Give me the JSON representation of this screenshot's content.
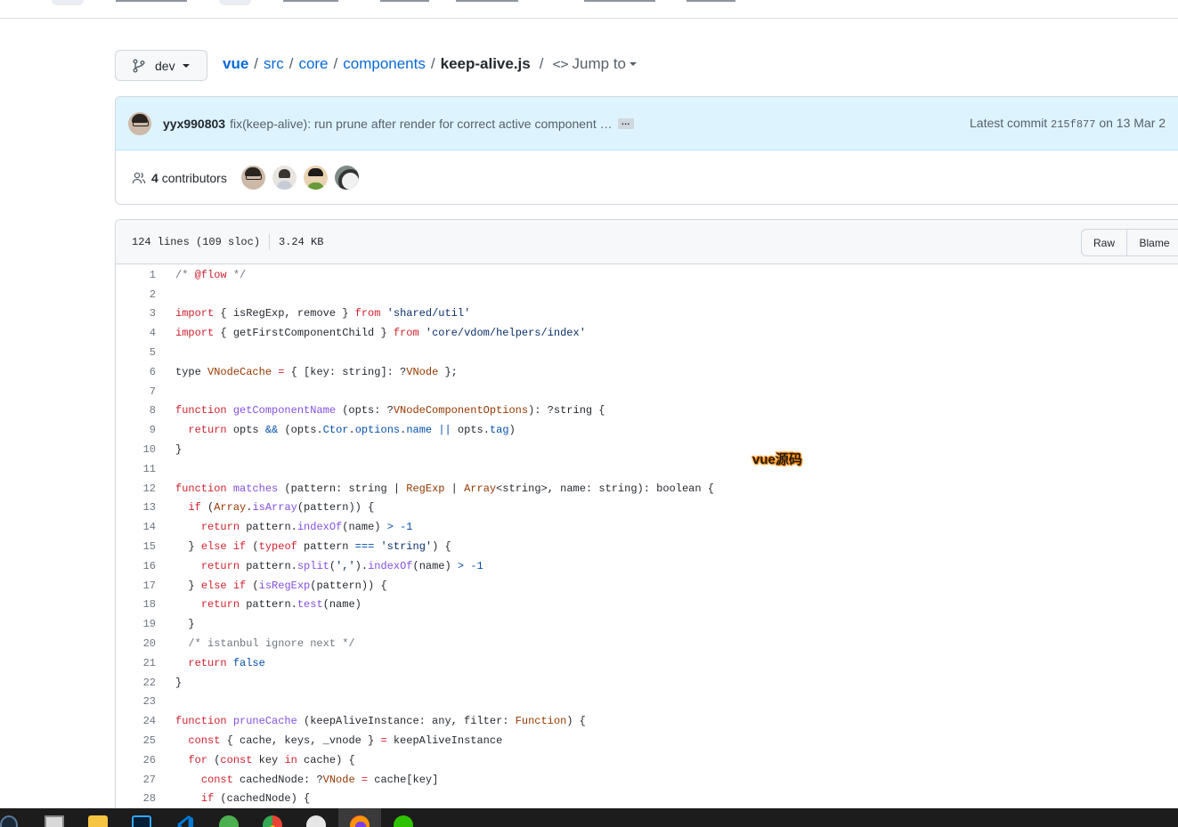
{
  "branch": {
    "name": "dev"
  },
  "breadcrumb": {
    "repo": "vue",
    "parts": [
      "src",
      "core",
      "components"
    ],
    "file": "keep-alive.js",
    "jump_to": "Jump to"
  },
  "commit": {
    "author": "yyx990803",
    "message": "fix(keep-alive): run prune after render for correct active component …",
    "ellipsis": "…",
    "latest_prefix": "Latest commit",
    "sha": "215f877",
    "date_text": "on 13 Mar 2"
  },
  "contributors": {
    "count": "4",
    "label": "contributors"
  },
  "file": {
    "lines_info": "124 lines (109 sloc)",
    "size": "3.24 KB",
    "raw_label": "Raw",
    "blame_label": "Blame"
  },
  "watermark": "vue源码",
  "code_lines": [
    "1",
    "2",
    "3",
    "4",
    "5",
    "6",
    "7",
    "8",
    "9",
    "10",
    "11",
    "12",
    "13",
    "14",
    "15",
    "16",
    "17",
    "18",
    "19",
    "20",
    "21",
    "22",
    "23",
    "24",
    "25",
    "26",
    "27",
    "28"
  ],
  "colors": {
    "link": "#0969da",
    "keyword": "#cf222e",
    "function": "#8250df",
    "string": "#0a3069",
    "comment": "#6e7781",
    "commit_bg": "#ddf4ff"
  },
  "taskbar": {
    "icons": [
      "steam-icon",
      "task-view-icon",
      "folder-icon",
      "photoshop-icon",
      "vscode-icon",
      "app-icon",
      "chrome-icon",
      "app-icon",
      "firefox-icon",
      "wechat-icon"
    ]
  }
}
